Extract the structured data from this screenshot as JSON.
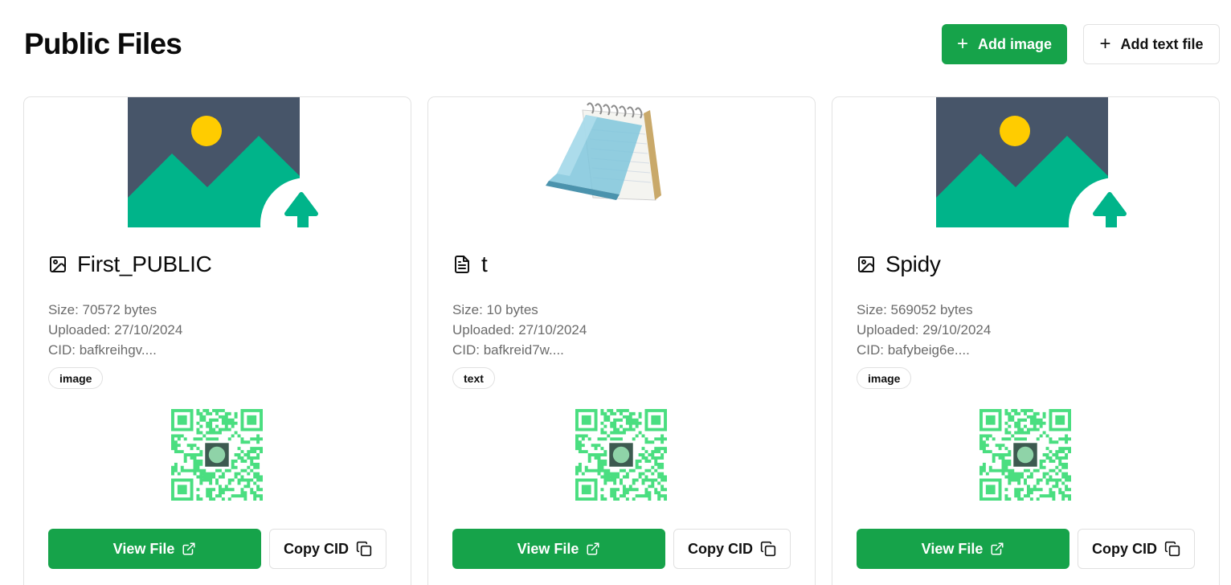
{
  "header": {
    "title": "Public Files",
    "add_image_label": "Add image",
    "add_text_label": "Add text file"
  },
  "colors": {
    "primary": "#16a34a",
    "image_bg": "#475569",
    "mountain": "#00b48a",
    "sun": "#ffcc00",
    "qr": "#4ade80"
  },
  "files": [
    {
      "name": "First_PUBLIC",
      "type_icon": "image-icon",
      "size": "Size: 70572 bytes",
      "uploaded": "Uploaded: 27/10/2024",
      "cid": "CID: bafkreihgv....",
      "badge": "image",
      "view_label": "View File",
      "copy_label": "Copy CID"
    },
    {
      "name": "t",
      "type_icon": "file-text-icon",
      "size": "Size: 10 bytes",
      "uploaded": "Uploaded: 27/10/2024",
      "cid": "CID: bafkreid7w....",
      "badge": "text",
      "view_label": "View File",
      "copy_label": "Copy CID"
    },
    {
      "name": "Spidy",
      "type_icon": "image-icon",
      "size": "Size: 569052 bytes",
      "uploaded": "Uploaded: 29/10/2024",
      "cid": "CID: bafybeig6e....",
      "badge": "image",
      "view_label": "View File",
      "copy_label": "Copy CID"
    }
  ]
}
